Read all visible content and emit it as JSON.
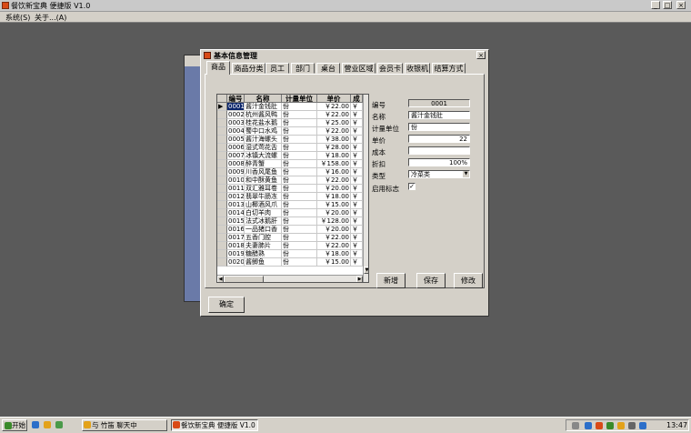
{
  "window": {
    "title": "餐饮新宝典 便捷版 V1.0",
    "minimize": "_",
    "maximize": "□",
    "close": "×"
  },
  "menubar": {
    "items": [
      "系统(S)",
      "关于...(A)"
    ]
  },
  "dialog": {
    "title": "基本信息管理",
    "close": "×",
    "tabs": [
      "商品",
      "商品分类",
      "员工",
      "部门",
      "桌台",
      "营业区域",
      "会员卡",
      "收银机",
      "结算方式"
    ],
    "active_tab": "商品",
    "ok_button": "确定"
  },
  "grid": {
    "columns": [
      "编号",
      "名称",
      "计量单位",
      "单价",
      "成"
    ],
    "rows": [
      [
        "0001",
        "酱汁金钱肚",
        "份",
        "￥22.00",
        "￥"
      ],
      [
        "0002",
        "杭州酱风鸭",
        "份",
        "￥22.00",
        "￥"
      ],
      [
        "0003",
        "桂花盐水鹅",
        "份",
        "￥25.00",
        "￥"
      ],
      [
        "0004",
        "蜀中口水鸡",
        "份",
        "￥22.00",
        "￥"
      ],
      [
        "0005",
        "酱汁海螺头",
        "份",
        "￥38.00",
        "￥"
      ],
      [
        "0006",
        "湿式莺花舌",
        "份",
        "￥28.00",
        "￥"
      ],
      [
        "0007",
        "冰镇大流螺",
        "份",
        "￥18.00",
        "￥"
      ],
      [
        "0008",
        "醉青蟹",
        "份",
        "￥158.00",
        "￥"
      ],
      [
        "0009",
        "川香风尾鱼",
        "份",
        "￥16.00",
        "￥"
      ],
      [
        "0010",
        "和中酥黄鱼",
        "份",
        "￥22.00",
        "￥"
      ],
      [
        "0011",
        "双汇雅耳卷",
        "份",
        "￥20.00",
        "￥"
      ],
      [
        "0012",
        "翡翠牛肠冻",
        "份",
        "￥18.00",
        "￥"
      ],
      [
        "0013",
        "山椰酒风爪",
        "份",
        "￥15.00",
        "￥"
      ],
      [
        "0014",
        "白切羊肉",
        "份",
        "￥20.00",
        "￥"
      ],
      [
        "0015",
        "法式冰鹅肝",
        "份",
        "￥128.00",
        "￥"
      ],
      [
        "0016",
        "一品猪口香",
        "份",
        "￥20.00",
        "￥"
      ],
      [
        "0017",
        "五香门腔",
        "份",
        "￥22.00",
        "￥"
      ],
      [
        "0018",
        "夫妻肺片",
        "份",
        "￥22.00",
        "￥"
      ],
      [
        "0019",
        "糖醋熟",
        "份",
        "￥18.00",
        "￥"
      ],
      [
        "0020",
        "酱鲫鱼",
        "份",
        "￥15.00",
        "￥"
      ]
    ]
  },
  "form": {
    "code_label": "编号",
    "code_value": "0001",
    "name_label": "名称",
    "name_value": "酱汁金钱肚",
    "unit_label": "计量单位",
    "unit_value": "份",
    "price_label": "单价",
    "price_value": "22",
    "cost_label": "成本",
    "cost_value": "",
    "discount_label": "折扣",
    "discount_value": "100%",
    "category_label": "类型",
    "category_value": "冷菜类",
    "enabled_label": "启用标志",
    "enabled_value": "✓",
    "add_button": "新增",
    "save_button": "保存",
    "edit_button": "修改"
  },
  "taskbar": {
    "start_label": "开始",
    "tasks": [
      "与 竹笛 聊天中",
      "餐饮新宝典 便捷版 V1.0"
    ],
    "clock": "13:47"
  }
}
